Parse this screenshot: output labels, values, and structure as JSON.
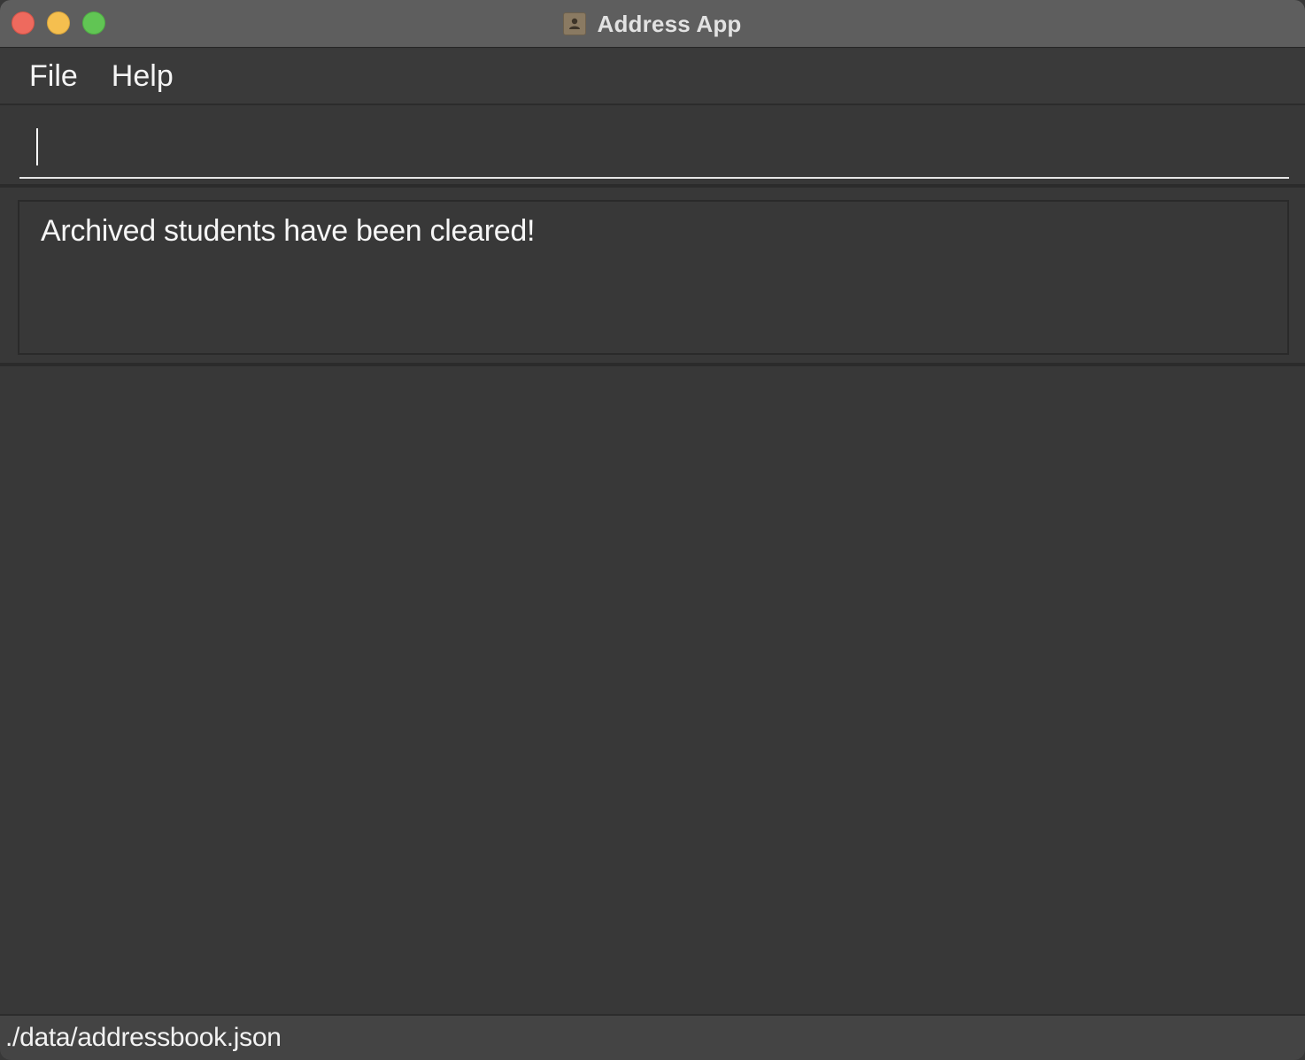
{
  "window": {
    "title": "Address App",
    "app_icon": "address-book-icon"
  },
  "menubar": {
    "items": [
      {
        "label": "File"
      },
      {
        "label": "Help"
      }
    ]
  },
  "command_box": {
    "value": "",
    "placeholder": ""
  },
  "result_display": {
    "message": "Archived students have been cleared!"
  },
  "status_bar": {
    "file_path": "./data/addressbook.json"
  },
  "colors": {
    "background": "#383838",
    "titlebar": "#5e5e5e",
    "close": "#ee6a5e",
    "minimize": "#f5bf4f",
    "zoom": "#61c554",
    "statusbar": "#444444"
  }
}
